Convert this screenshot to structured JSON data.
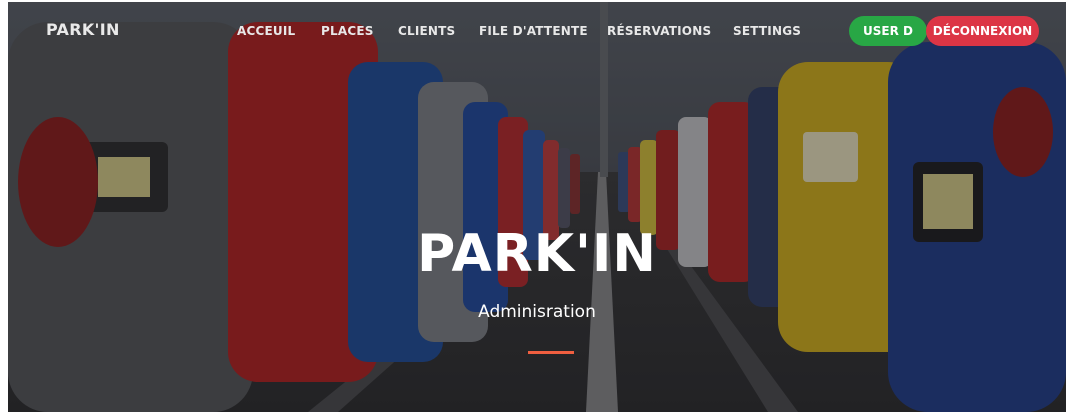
{
  "navbar": {
    "brand": "PARK'IN",
    "items": [
      "ACCEUIL",
      "PLACES",
      "CLIENTS",
      "FILE D'ATTENTE",
      "RÉSERVATIONS",
      "SETTINGS"
    ],
    "user_label": "USER D",
    "logout_label": "DÉCONNEXION"
  },
  "hero": {
    "title": "PARK'IN",
    "subtitle": "Adminisration"
  },
  "colors": {
    "user_button": "#28a745",
    "logout_button": "#dc3545",
    "divider_accent": "#f05f40"
  }
}
